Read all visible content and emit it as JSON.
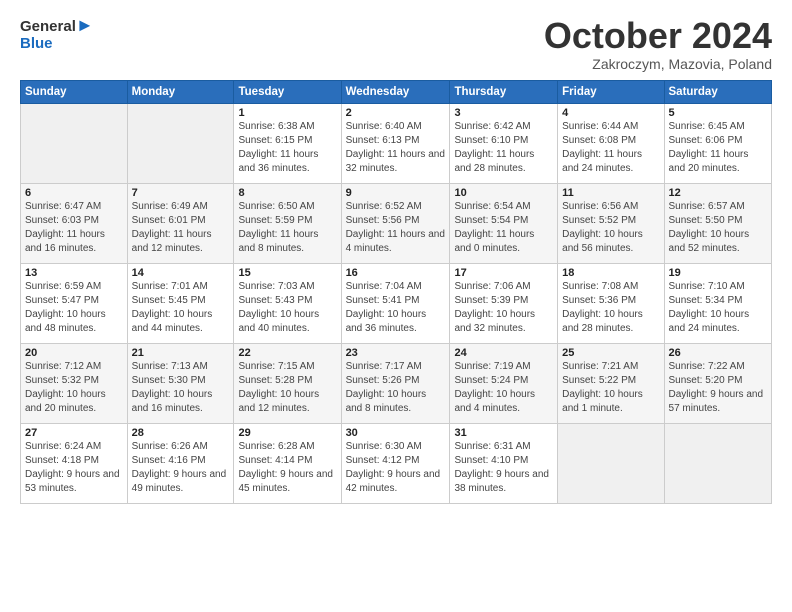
{
  "header": {
    "logo_line1": "General",
    "logo_line2": "Blue",
    "month": "October 2024",
    "location": "Zakroczym, Mazovia, Poland"
  },
  "days_of_week": [
    "Sunday",
    "Monday",
    "Tuesday",
    "Wednesday",
    "Thursday",
    "Friday",
    "Saturday"
  ],
  "weeks": [
    [
      {
        "day": "",
        "info": ""
      },
      {
        "day": "",
        "info": ""
      },
      {
        "day": "1",
        "info": "Sunrise: 6:38 AM\nSunset: 6:15 PM\nDaylight: 11 hours and 36 minutes."
      },
      {
        "day": "2",
        "info": "Sunrise: 6:40 AM\nSunset: 6:13 PM\nDaylight: 11 hours and 32 minutes."
      },
      {
        "day": "3",
        "info": "Sunrise: 6:42 AM\nSunset: 6:10 PM\nDaylight: 11 hours and 28 minutes."
      },
      {
        "day": "4",
        "info": "Sunrise: 6:44 AM\nSunset: 6:08 PM\nDaylight: 11 hours and 24 minutes."
      },
      {
        "day": "5",
        "info": "Sunrise: 6:45 AM\nSunset: 6:06 PM\nDaylight: 11 hours and 20 minutes."
      }
    ],
    [
      {
        "day": "6",
        "info": "Sunrise: 6:47 AM\nSunset: 6:03 PM\nDaylight: 11 hours and 16 minutes."
      },
      {
        "day": "7",
        "info": "Sunrise: 6:49 AM\nSunset: 6:01 PM\nDaylight: 11 hours and 12 minutes."
      },
      {
        "day": "8",
        "info": "Sunrise: 6:50 AM\nSunset: 5:59 PM\nDaylight: 11 hours and 8 minutes."
      },
      {
        "day": "9",
        "info": "Sunrise: 6:52 AM\nSunset: 5:56 PM\nDaylight: 11 hours and 4 minutes."
      },
      {
        "day": "10",
        "info": "Sunrise: 6:54 AM\nSunset: 5:54 PM\nDaylight: 11 hours and 0 minutes."
      },
      {
        "day": "11",
        "info": "Sunrise: 6:56 AM\nSunset: 5:52 PM\nDaylight: 10 hours and 56 minutes."
      },
      {
        "day": "12",
        "info": "Sunrise: 6:57 AM\nSunset: 5:50 PM\nDaylight: 10 hours and 52 minutes."
      }
    ],
    [
      {
        "day": "13",
        "info": "Sunrise: 6:59 AM\nSunset: 5:47 PM\nDaylight: 10 hours and 48 minutes."
      },
      {
        "day": "14",
        "info": "Sunrise: 7:01 AM\nSunset: 5:45 PM\nDaylight: 10 hours and 44 minutes."
      },
      {
        "day": "15",
        "info": "Sunrise: 7:03 AM\nSunset: 5:43 PM\nDaylight: 10 hours and 40 minutes."
      },
      {
        "day": "16",
        "info": "Sunrise: 7:04 AM\nSunset: 5:41 PM\nDaylight: 10 hours and 36 minutes."
      },
      {
        "day": "17",
        "info": "Sunrise: 7:06 AM\nSunset: 5:39 PM\nDaylight: 10 hours and 32 minutes."
      },
      {
        "day": "18",
        "info": "Sunrise: 7:08 AM\nSunset: 5:36 PM\nDaylight: 10 hours and 28 minutes."
      },
      {
        "day": "19",
        "info": "Sunrise: 7:10 AM\nSunset: 5:34 PM\nDaylight: 10 hours and 24 minutes."
      }
    ],
    [
      {
        "day": "20",
        "info": "Sunrise: 7:12 AM\nSunset: 5:32 PM\nDaylight: 10 hours and 20 minutes."
      },
      {
        "day": "21",
        "info": "Sunrise: 7:13 AM\nSunset: 5:30 PM\nDaylight: 10 hours and 16 minutes."
      },
      {
        "day": "22",
        "info": "Sunrise: 7:15 AM\nSunset: 5:28 PM\nDaylight: 10 hours and 12 minutes."
      },
      {
        "day": "23",
        "info": "Sunrise: 7:17 AM\nSunset: 5:26 PM\nDaylight: 10 hours and 8 minutes."
      },
      {
        "day": "24",
        "info": "Sunrise: 7:19 AM\nSunset: 5:24 PM\nDaylight: 10 hours and 4 minutes."
      },
      {
        "day": "25",
        "info": "Sunrise: 7:21 AM\nSunset: 5:22 PM\nDaylight: 10 hours and 1 minute."
      },
      {
        "day": "26",
        "info": "Sunrise: 7:22 AM\nSunset: 5:20 PM\nDaylight: 9 hours and 57 minutes."
      }
    ],
    [
      {
        "day": "27",
        "info": "Sunrise: 6:24 AM\nSunset: 4:18 PM\nDaylight: 9 hours and 53 minutes."
      },
      {
        "day": "28",
        "info": "Sunrise: 6:26 AM\nSunset: 4:16 PM\nDaylight: 9 hours and 49 minutes."
      },
      {
        "day": "29",
        "info": "Sunrise: 6:28 AM\nSunset: 4:14 PM\nDaylight: 9 hours and 45 minutes."
      },
      {
        "day": "30",
        "info": "Sunrise: 6:30 AM\nSunset: 4:12 PM\nDaylight: 9 hours and 42 minutes."
      },
      {
        "day": "31",
        "info": "Sunrise: 6:31 AM\nSunset: 4:10 PM\nDaylight: 9 hours and 38 minutes."
      },
      {
        "day": "",
        "info": ""
      },
      {
        "day": "",
        "info": ""
      }
    ]
  ]
}
